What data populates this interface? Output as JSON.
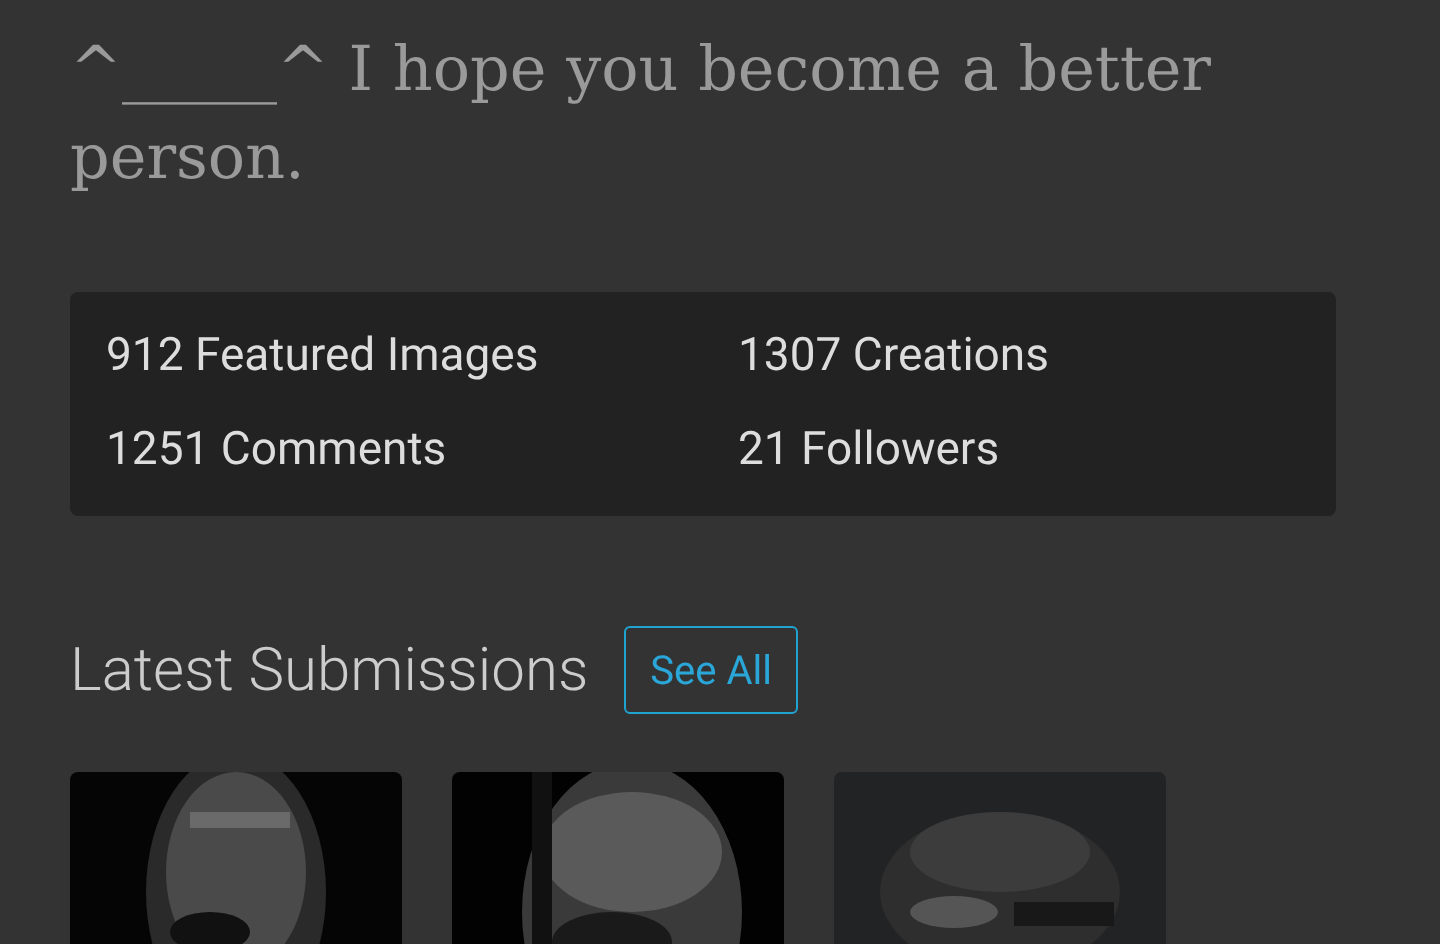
{
  "bio": "^_____^ I hope you become a better person.",
  "stats": [
    {
      "label": "912 Featured Images"
    },
    {
      "label": "1307 Creations"
    },
    {
      "label": "1251 Comments"
    },
    {
      "label": "21 Followers"
    }
  ],
  "latest_submissions": {
    "title": "Latest Submissions",
    "see_all": "See All"
  }
}
